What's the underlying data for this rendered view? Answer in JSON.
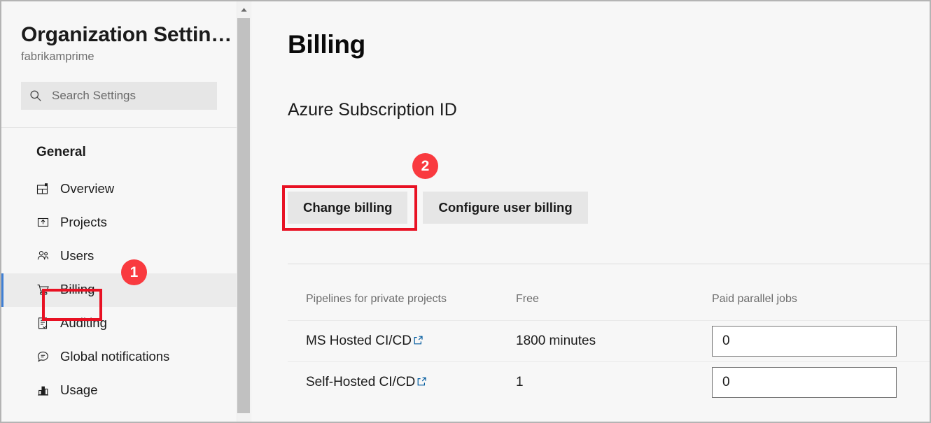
{
  "colors": {
    "accent_blue": "#3f7fd4",
    "link_blue": "#005a9e",
    "annotation_red": "#e81123",
    "badge_red": "#f93a3f",
    "sidebar_bg": "#f7f7f7",
    "selected_row_bg": "#ebebeb",
    "button_bg": "#e6e6e6"
  },
  "sidebar": {
    "org_title": "Organization Settin…",
    "org_subtitle": "fabrikamprime",
    "search": {
      "icon": "search-icon",
      "placeholder": "Search Settings",
      "value": ""
    },
    "group_title": "General",
    "items": [
      {
        "label": "Overview",
        "icon": "overview-grid-icon",
        "selected": false
      },
      {
        "label": "Projects",
        "icon": "projects-upload-box-icon",
        "selected": false
      },
      {
        "label": "Users",
        "icon": "users-people-icon",
        "selected": false
      },
      {
        "label": "Billing",
        "icon": "billing-cart-icon",
        "selected": true
      },
      {
        "label": "Auditing",
        "icon": "auditing-clipboard-check-icon",
        "selected": false
      },
      {
        "label": "Global notifications",
        "icon": "notifications-speech-bubble-icon",
        "selected": false
      },
      {
        "label": "Usage",
        "icon": "usage-bar-chart-icon",
        "selected": false
      }
    ],
    "scrollbar": {
      "up_arrow_icon": "chevron-up-icon"
    }
  },
  "main": {
    "page_title": "Billing",
    "section_title": "Azure Subscription ID",
    "buttons": [
      {
        "label": "Change billing",
        "highlighted": true
      },
      {
        "label": "Configure user billing",
        "highlighted": false
      }
    ]
  },
  "table": {
    "headers": [
      "Pipelines for private projects",
      "Free",
      "Paid parallel jobs"
    ],
    "rows": [
      {
        "name": "MS Hosted CI/CD",
        "name_link_icon": "external-link-icon",
        "free": "1800 minutes",
        "paid": "0"
      },
      {
        "name": "Self-Hosted CI/CD",
        "name_link_icon": "external-link-icon",
        "free": "1",
        "paid": "0"
      }
    ]
  },
  "annotations": [
    {
      "number": "1",
      "target": "sidebar-item-billing"
    },
    {
      "number": "2",
      "target": "change-billing-button"
    }
  ]
}
